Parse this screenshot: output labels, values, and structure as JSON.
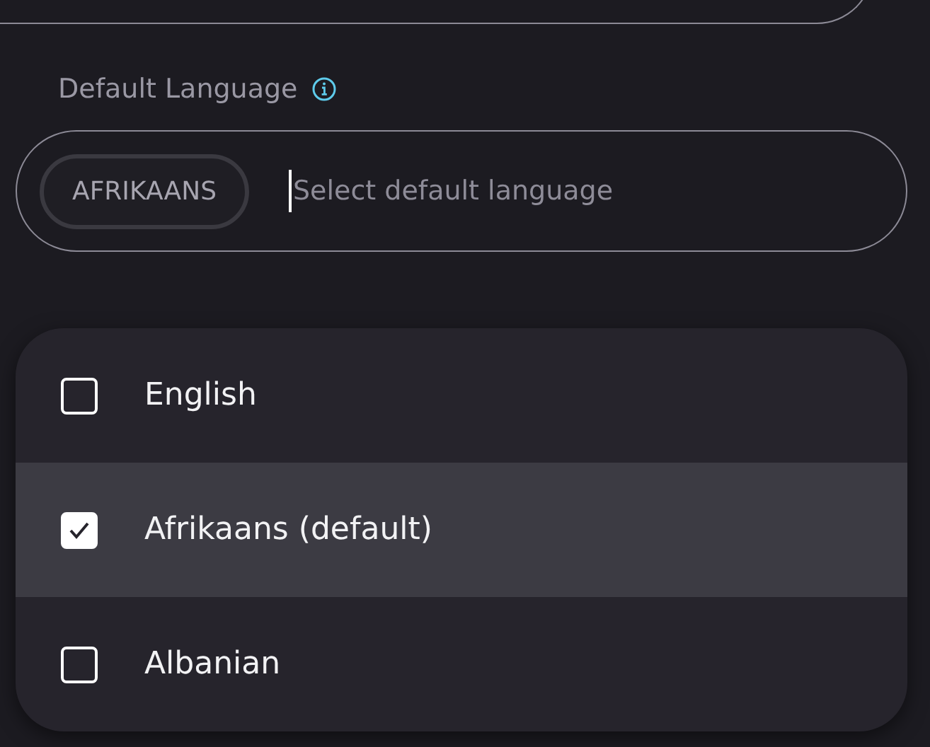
{
  "field": {
    "label": "Default Language",
    "chip": "AFRIKAANS",
    "placeholder": "Select default language"
  },
  "options": [
    {
      "label": "English",
      "checked": false,
      "highlighted": false
    },
    {
      "label": "Afrikaans (default)",
      "checked": true,
      "highlighted": true
    },
    {
      "label": "Albanian",
      "checked": false,
      "highlighted": false
    }
  ]
}
